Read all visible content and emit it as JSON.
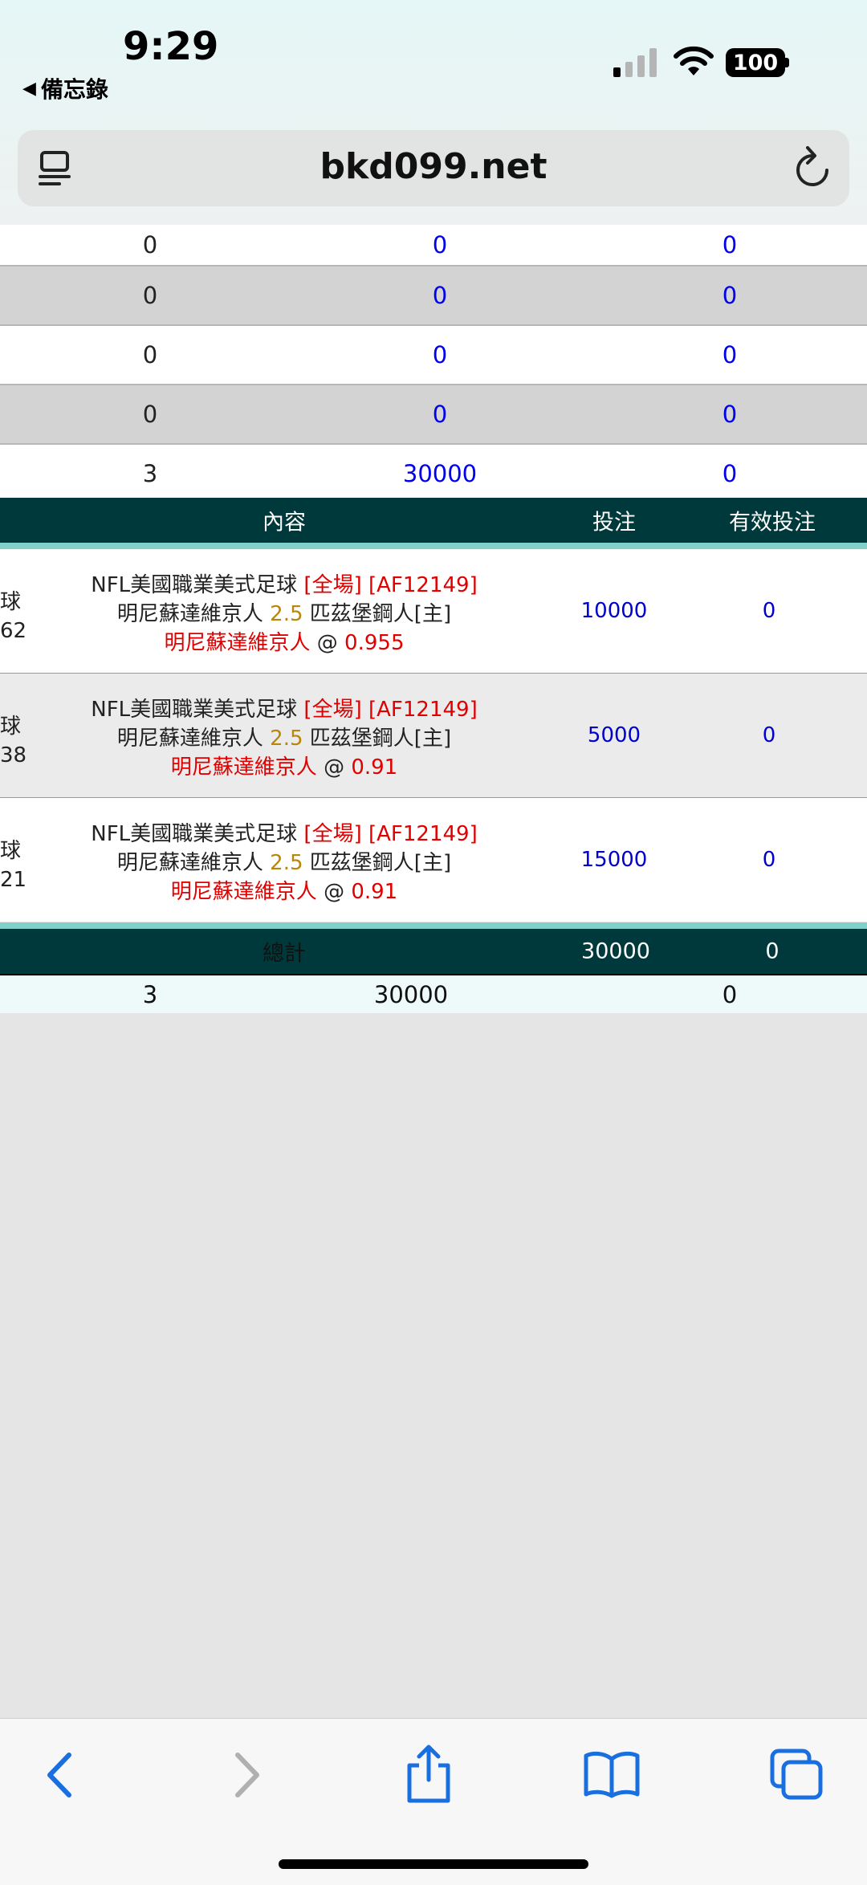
{
  "status": {
    "time": "9:29",
    "back_app": "備忘錄",
    "battery": "100"
  },
  "browser": {
    "url": "bkd099.net"
  },
  "summary_rows": [
    {
      "count": "0",
      "bet": "0",
      "valid": "0"
    },
    {
      "count": "0",
      "bet": "0",
      "valid": "0"
    },
    {
      "count": "0",
      "bet": "0",
      "valid": "0"
    },
    {
      "count": "0",
      "bet": "0",
      "valid": "0"
    },
    {
      "count": "3",
      "bet": "30000",
      "valid": "0"
    }
  ],
  "detail_header": {
    "content": "內容",
    "bet": "投注",
    "valid": "有效投注"
  },
  "details": [
    {
      "left1": "球",
      "left2": "62",
      "league": "NFL美國職業美式足球",
      "scope": "[全場]",
      "code": "[AF12149]",
      "home": "明尼蘇達維京人",
      "handicap": "2.5",
      "away": "匹茲堡鋼人[主]",
      "pick": "明尼蘇達維京人",
      "at": "@",
      "odds": "0.955",
      "bet": "10000",
      "valid": "0"
    },
    {
      "left1": "球",
      "left2": "38",
      "league": "NFL美國職業美式足球",
      "scope": "[全場]",
      "code": "[AF12149]",
      "home": "明尼蘇達維京人",
      "handicap": "2.5",
      "away": "匹茲堡鋼人[主]",
      "pick": "明尼蘇達維京人",
      "at": "@",
      "odds": "0.91",
      "bet": "5000",
      "valid": "0"
    },
    {
      "left1": "球",
      "left2": "21",
      "league": "NFL美國職業美式足球",
      "scope": "[全場]",
      "code": "[AF12149]",
      "home": "明尼蘇達維京人",
      "handicap": "2.5",
      "away": "匹茲堡鋼人[主]",
      "pick": "明尼蘇達維京人",
      "at": "@",
      "odds": "0.91",
      "bet": "15000",
      "valid": "0"
    }
  ],
  "totals": {
    "label": "總計",
    "bet": "30000",
    "valid": "0"
  },
  "final_row": {
    "count": "3",
    "bet": "30000",
    "valid": "0"
  },
  "toolbar": {
    "icons": [
      "back-icon",
      "forward-icon",
      "share-icon",
      "bookmarks-icon",
      "tabs-icon"
    ]
  }
}
